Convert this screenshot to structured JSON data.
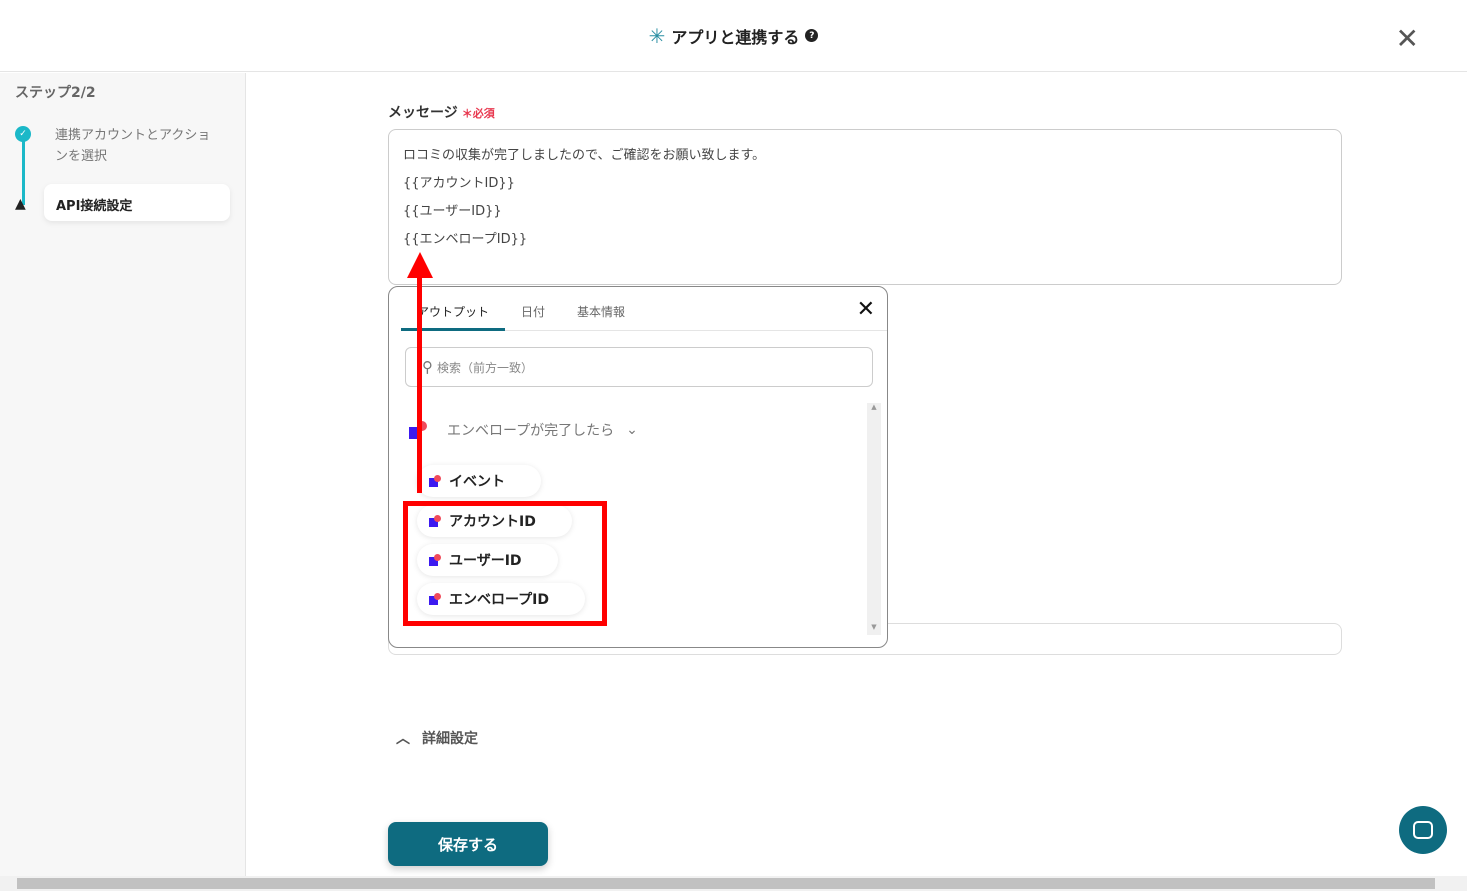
{
  "header": {
    "title": "アプリと連携する",
    "help_icon": "question-circle-icon",
    "close_icon": "close-icon"
  },
  "sidebar": {
    "step_label": "ステップ2/2",
    "steps": [
      {
        "label": "連携アカウントとアクションを選択",
        "status": "done"
      },
      {
        "label": "API接続設定",
        "status": "warning"
      }
    ]
  },
  "form": {
    "message_label": "メッセージ",
    "required_label": "必須",
    "message_lines": [
      "ロコミの収集が完了しましたので、ご確認をお願い致します。",
      "{{アカウントID}}",
      "{{ユーザーID}}",
      "{{エンベロープID}}"
    ]
  },
  "panel": {
    "tabs": [
      "アウトプット",
      "日付",
      "基本情報"
    ],
    "search_placeholder": "検索（前方一致）",
    "group_label": "エンベロープが完了したら",
    "items": [
      "イベント",
      "アカウントID",
      "ユーザーID",
      "エンベロープID"
    ]
  },
  "advanced_label": "詳細設定",
  "save_label": "保存する",
  "colors": {
    "accent": "#0e6b80",
    "highlight": "#ff0000",
    "step": "#1bb8c8"
  }
}
